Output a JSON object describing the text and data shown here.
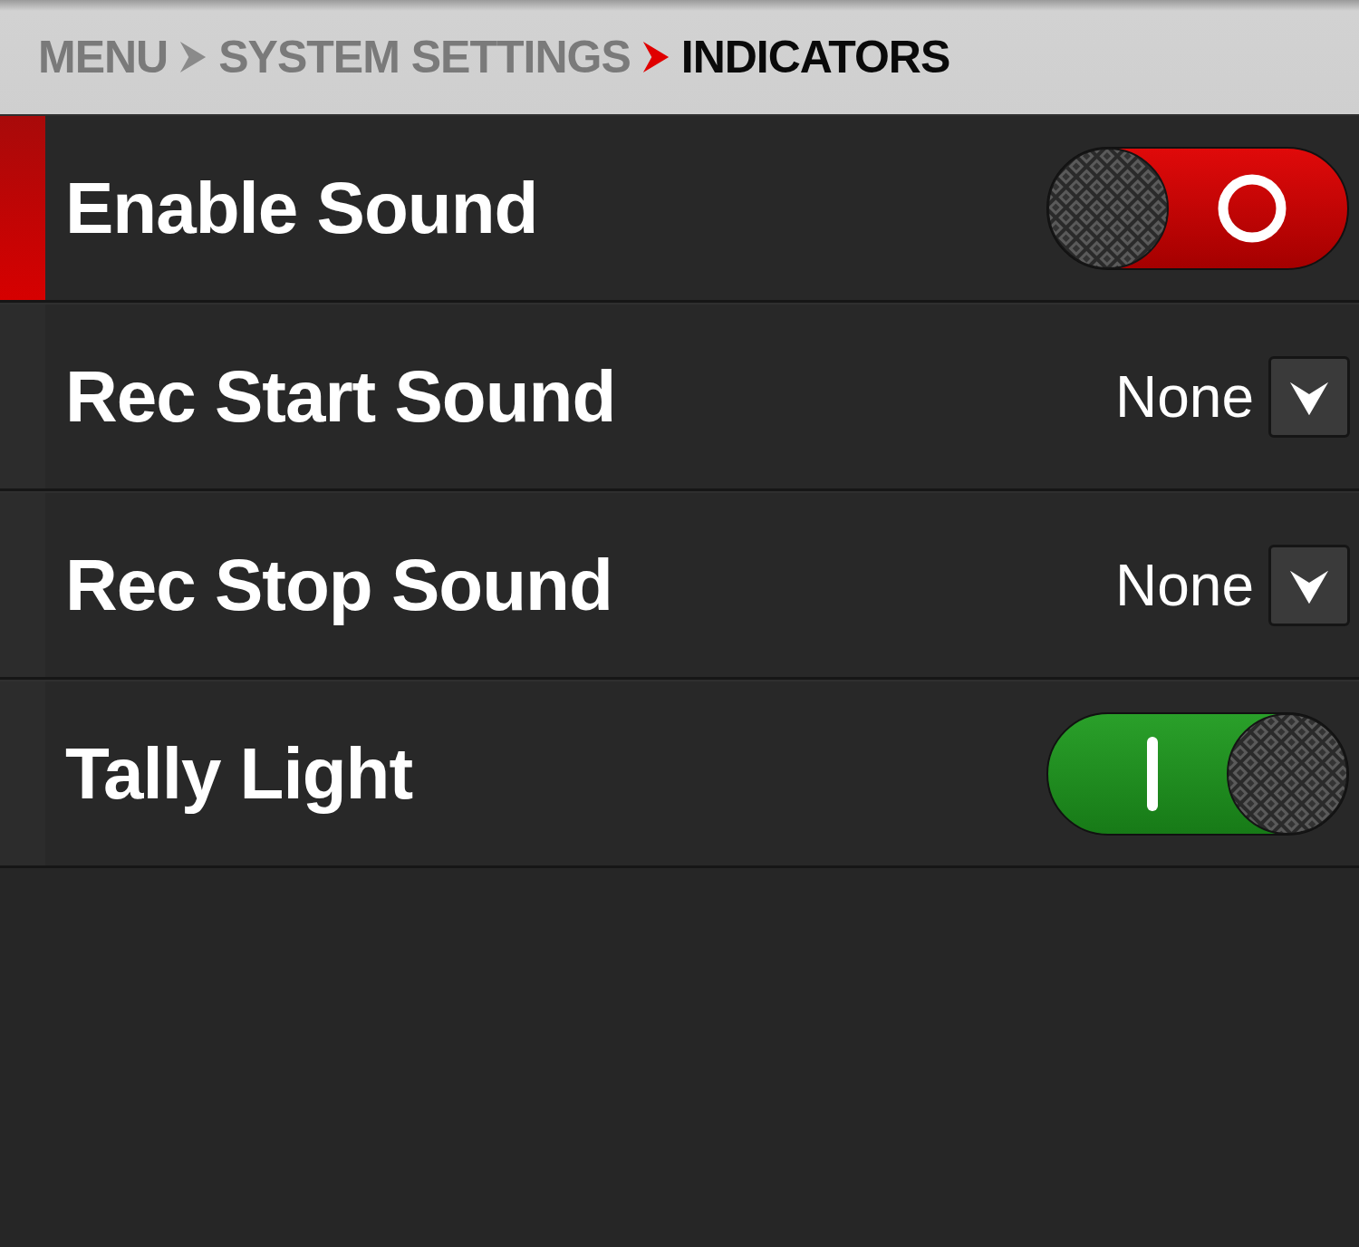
{
  "breadcrumb": [
    {
      "label": "MENU",
      "current": false
    },
    {
      "label": "SYSTEM SETTINGS",
      "current": false
    },
    {
      "label": "INDICATORS",
      "current": true
    }
  ],
  "rows": [
    {
      "kind": "toggle",
      "label": "Enable Sound",
      "selected": true,
      "on": false
    },
    {
      "kind": "dropdown",
      "label": "Rec Start Sound",
      "selected": false,
      "value": "None"
    },
    {
      "kind": "dropdown",
      "label": "Rec Stop Sound",
      "selected": false,
      "value": "None"
    },
    {
      "kind": "toggle",
      "label": "Tally Light",
      "selected": false,
      "on": true
    }
  ]
}
